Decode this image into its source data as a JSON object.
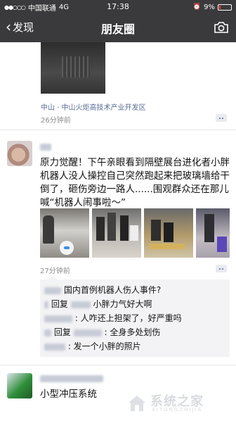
{
  "status": {
    "carrier": "中国联通",
    "network": "4G",
    "time": "17:38",
    "battery": "9%"
  },
  "nav": {
    "back_label": "发现",
    "title": "朋友圈",
    "camera_icon": "camera-icon"
  },
  "post1": {
    "location": "中山 · 中山火炬高技术产业开发区",
    "time": "26分钟前"
  },
  "post2": {
    "text": "原力觉醒！下午亲眼看到隔壁展台进化者小胖机器人没人操控自己突然跑起来把玻璃墙给干倒了，砸伤旁边一路人......围观群众还在那儿喊“机器人闹事啦～”",
    "time": "27分钟前",
    "comments": [
      {
        "name": "",
        "reply_to": "",
        "text": "国内首例机器人伤人事件?"
      },
      {
        "name": "",
        "reply_to": "回复",
        "text": "小胖力气好大啊"
      },
      {
        "name": "",
        "reply_to": "",
        "text": ": 人咋还上担架了，好严重吗"
      },
      {
        "name": "",
        "reply_to": "回复",
        "text": ": 全身多处划伤"
      },
      {
        "name": "",
        "reply_to": "",
        "text": ": 发一个小胖的照片"
      }
    ]
  },
  "post3": {
    "text": "小型冲压系统"
  },
  "watermark": {
    "text": "系统之家",
    "sub": "XITONGZHIJIA"
  },
  "colors": {
    "link": "#576b95",
    "navbar": "#3a3a3c"
  }
}
